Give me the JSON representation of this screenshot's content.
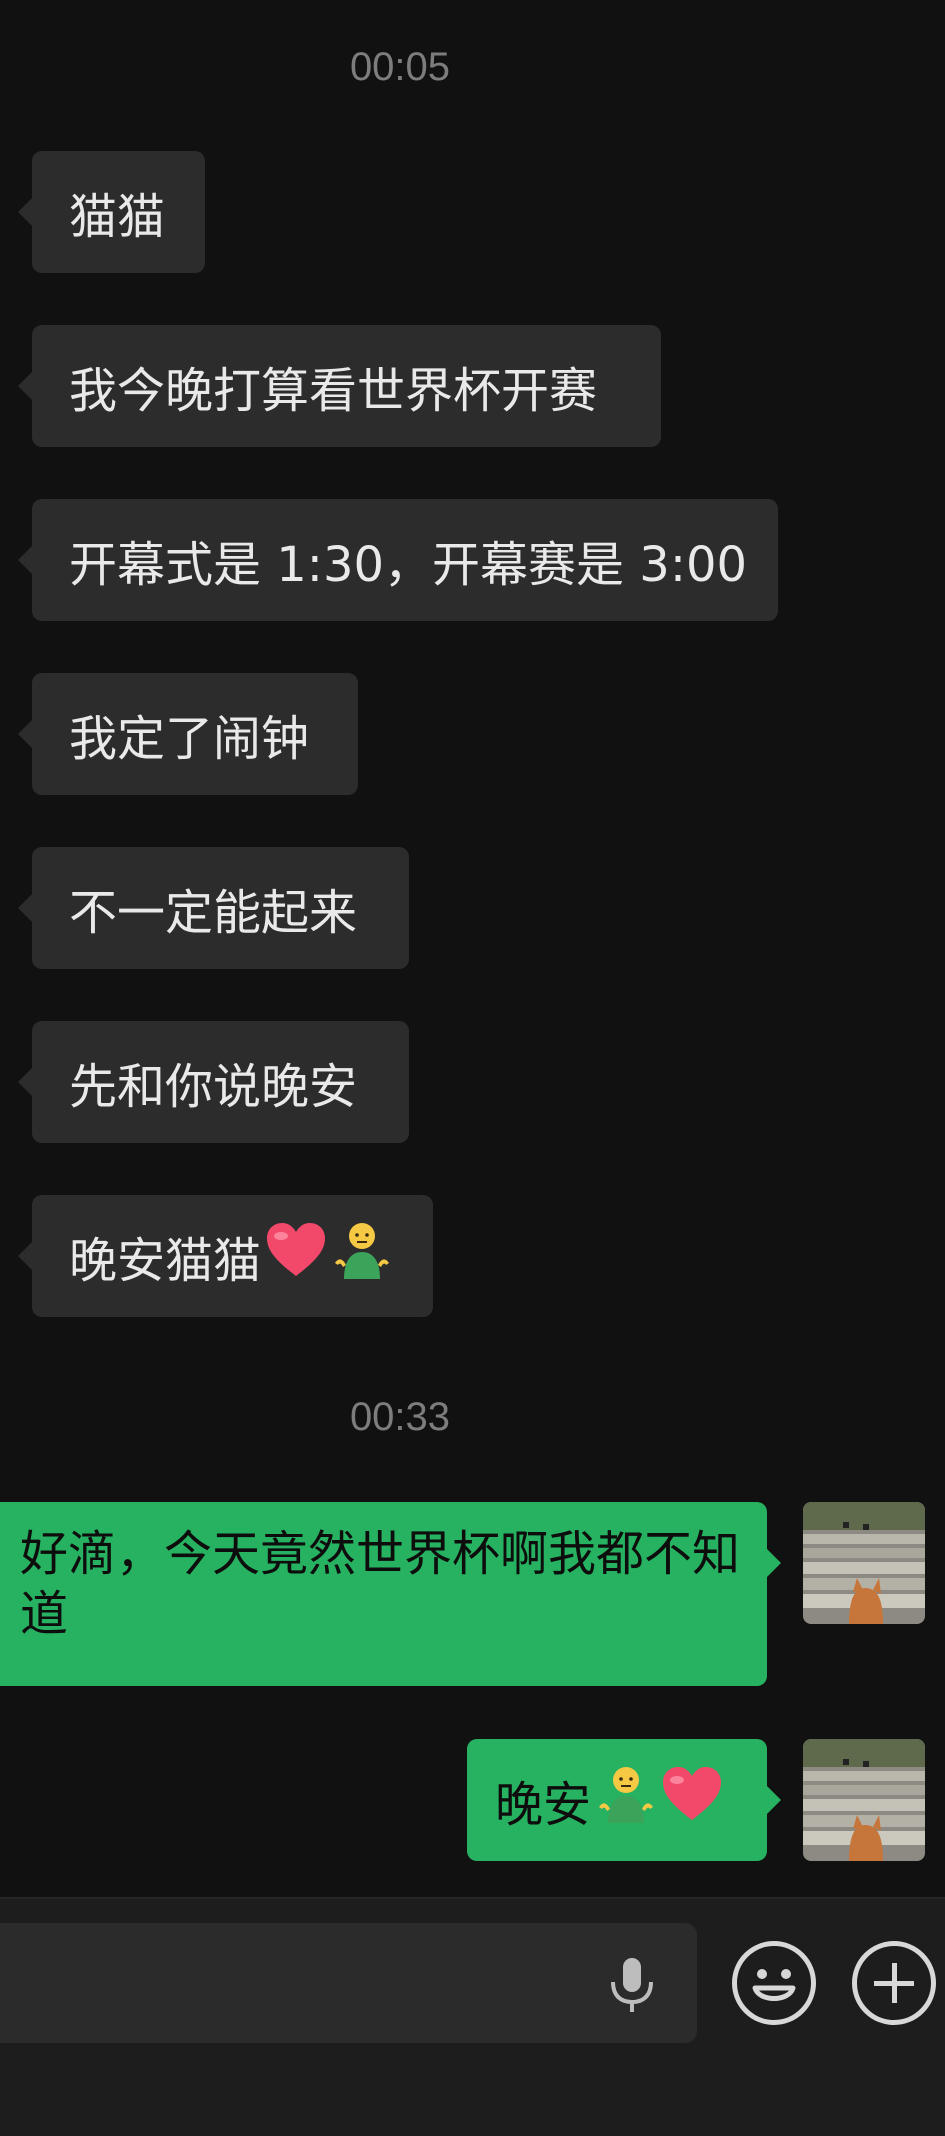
{
  "chat": {
    "timestamps": [
      "00:05",
      "00:33"
    ],
    "incoming": [
      "猫猫",
      "我今晚打算看世界杯开赛",
      "开幕式是 1:30，开幕赛是 3:00",
      "我定了闹钟",
      "不一定能起来",
      "先和你说晚安",
      "晚安猫猫"
    ],
    "outgoing": [
      "好滴，今天竟然世界杯啊我都不知道",
      "晚安"
    ]
  },
  "icons": {
    "heart": "red-heart-emoji",
    "shrug": "shrugging-person-emoji",
    "voice": "microphone-icon",
    "sticker": "smiley-icon",
    "more": "plus-icon"
  },
  "colors": {
    "background": "#111111",
    "incoming_bubble": "#2c2c2c",
    "outgoing_bubble": "#26b260",
    "bottom_bar": "#1d1d1d"
  }
}
